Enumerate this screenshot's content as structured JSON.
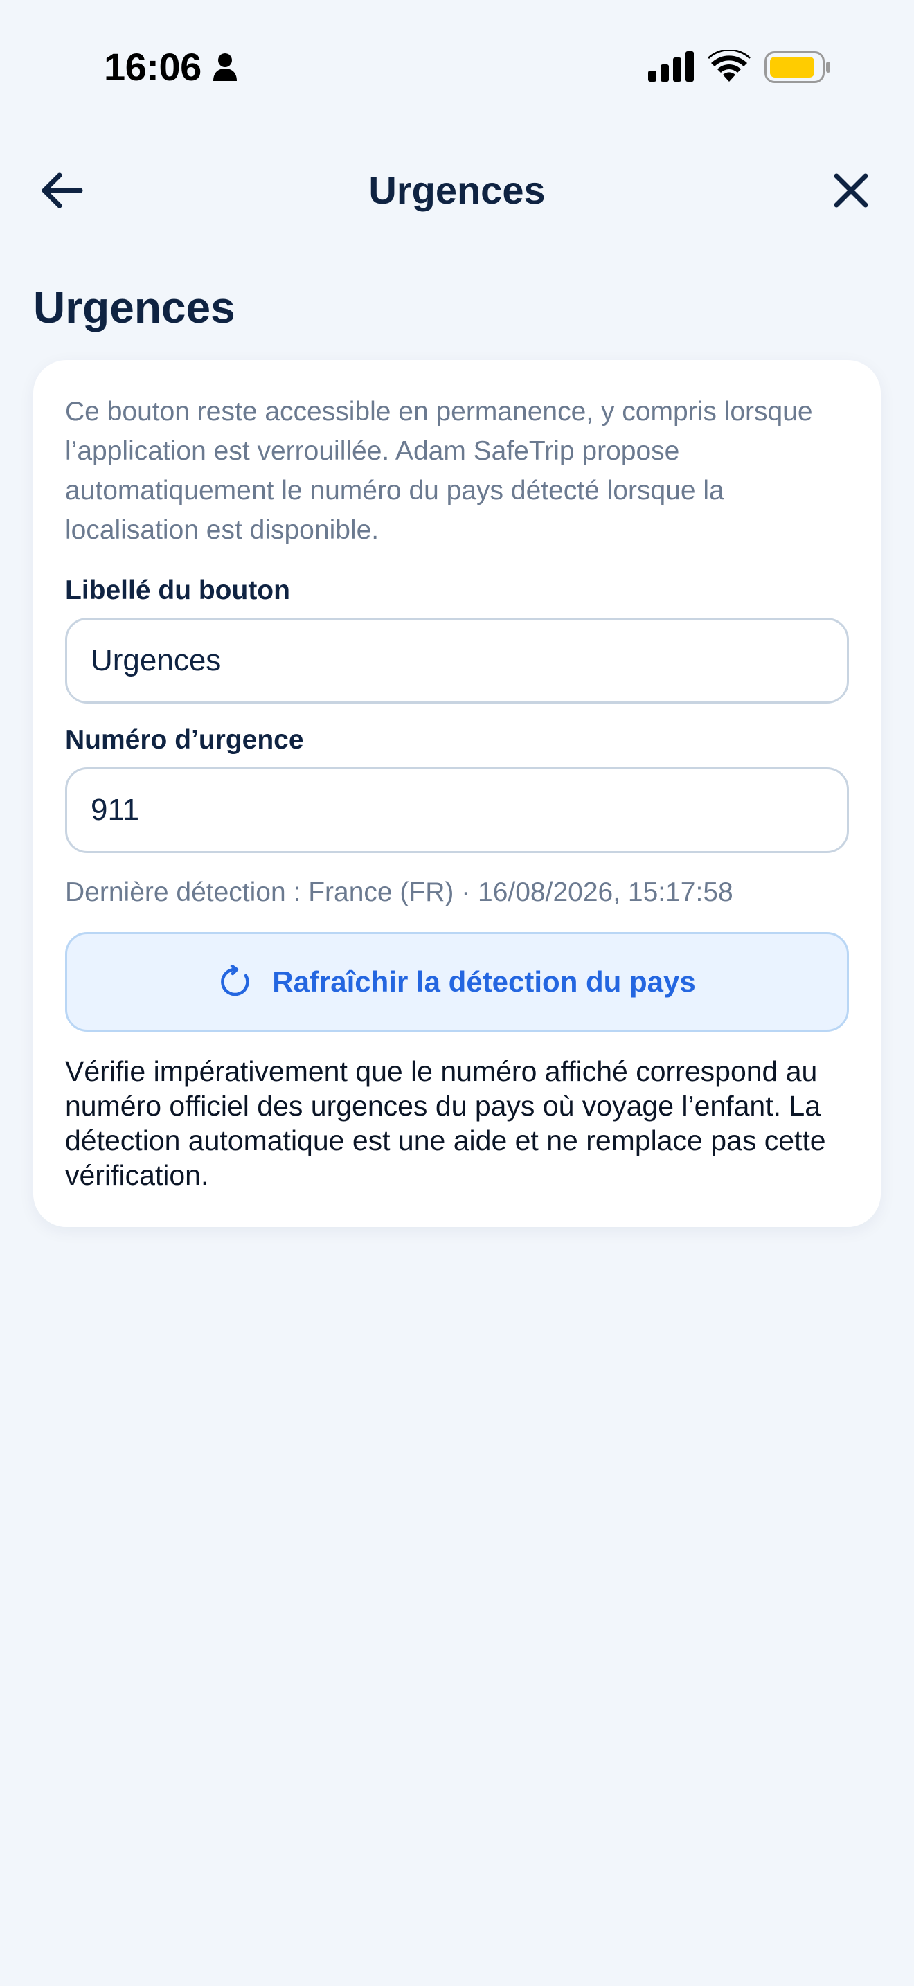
{
  "status_bar": {
    "time": "16:06",
    "person_icon": "person-fill-icon",
    "signal_icon": "cellular-signal-icon",
    "wifi_icon": "wifi-icon",
    "battery_icon": "battery-icon",
    "battery_color": "#FFCC00"
  },
  "nav": {
    "title": "Urgences",
    "back_icon": "arrow-left-icon",
    "close_icon": "close-icon"
  },
  "page": {
    "title": "Urgences"
  },
  "card": {
    "intro": "Ce bouton reste accessible en permanence, y compris lorsque l’application est verrouillée. Adam SafeTrip propose automatiquement le numéro du pays détecté lorsque la localisation est disponible.",
    "button_label_field": {
      "label": "Libellé du bouton",
      "value": "Urgences"
    },
    "emergency_number_field": {
      "label": "Numéro d’urgence",
      "value": "911"
    },
    "last_detection": "Dernière détection : France (FR) · 16/08/2026, 15:17:58",
    "refresh_button": {
      "label": "Rafraîchir la détection du pays",
      "icon": "refresh-icon"
    },
    "warning": "Vérifie impérativement que le numéro affiché correspond au numéro officiel des urgences du pays où voyage l’enfant. La détection automatique est une aide et ne remplace pas cette vérification."
  },
  "colors": {
    "background": "#F2F6FB",
    "primary_text": "#0F2342",
    "secondary_text": "#6B7A90",
    "accent": "#2466E0",
    "accent_bg": "#EAF3FF"
  }
}
